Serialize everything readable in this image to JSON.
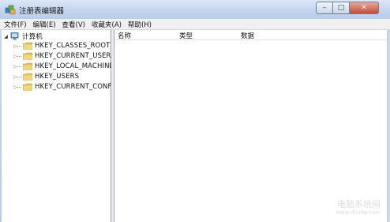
{
  "window": {
    "title": "注册表编辑器",
    "controls": {
      "minimize": "–",
      "maximize": "□",
      "close": "✕"
    }
  },
  "menu": [
    "文件(F)",
    "编辑(E)",
    "查看(V)",
    "收藏夹(A)",
    "帮助(H)"
  ],
  "tree": {
    "root": {
      "label": "计算机",
      "expanded": true,
      "icon": "computer-icon"
    },
    "children": [
      {
        "label": "HKEY_CLASSES_ROOT",
        "icon": "folder-icon"
      },
      {
        "label": "HKEY_CURRENT_USER",
        "icon": "folder-icon"
      },
      {
        "label": "HKEY_LOCAL_MACHINE",
        "icon": "folder-icon"
      },
      {
        "label": "HKEY_USERS",
        "icon": "folder-icon"
      },
      {
        "label": "HKEY_CURRENT_CONFIG",
        "icon": "folder-icon"
      }
    ]
  },
  "list": {
    "columns": [
      "名称",
      "类型",
      "数据"
    ]
  },
  "watermark": {
    "line1": "电脑系统网",
    "line2": "www.dnxtw.com"
  },
  "colors": {
    "title_bar": "#c3d5ee",
    "close_button": "#c94a32",
    "folder": "#e7c25a"
  }
}
